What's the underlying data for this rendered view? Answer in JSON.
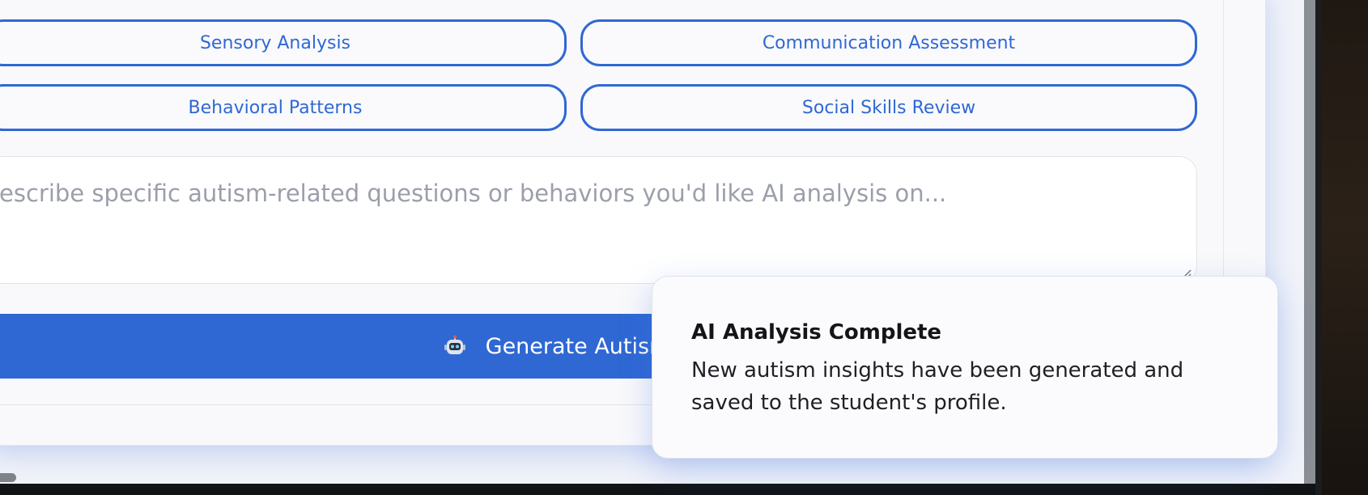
{
  "quick_actions": [
    {
      "label": "Sensory Analysis"
    },
    {
      "label": "Communication Assessment"
    },
    {
      "label": "Behavioral Patterns"
    },
    {
      "label": "Social Skills Review"
    }
  ],
  "query": {
    "placeholder": "escribe specific autism-related questions or behaviors you'd like AI analysis on..."
  },
  "generate_button": {
    "icon": "robot-icon",
    "label": "Generate Autism-Speci"
  },
  "toast": {
    "title": "AI Analysis Complete",
    "message": "New autism insights have been generated and saved to the student's profile."
  },
  "colors": {
    "accent": "#2f68d3",
    "panel": "#f9f9fb",
    "placeholder": "#9b9fa9"
  }
}
